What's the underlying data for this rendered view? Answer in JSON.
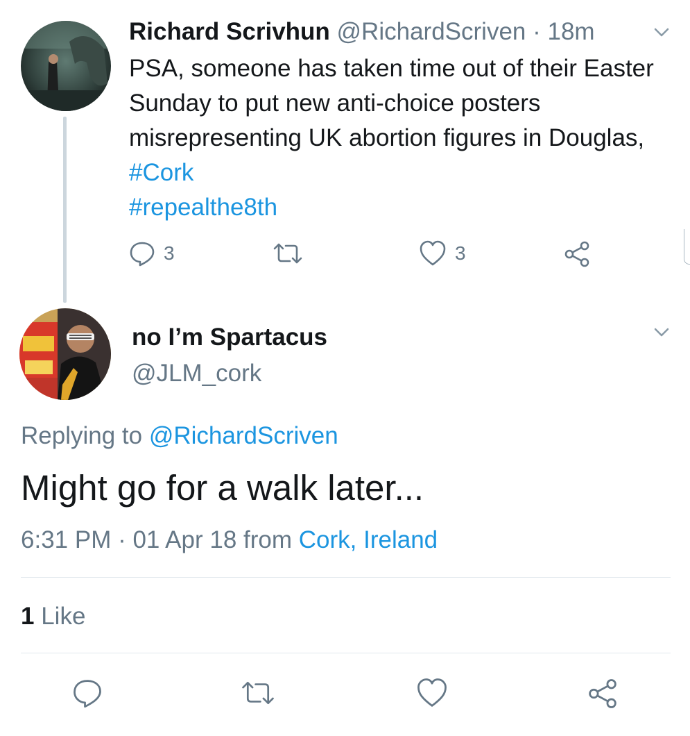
{
  "parent_tweet": {
    "display_name": "Richard Scrivhun",
    "handle": "@RichardScriven",
    "time": "18m",
    "text_plain": "PSA, someone has taken time out of their Easter Sunday to put new anti-choice posters misrepresenting UK abortion figures in Douglas,",
    "hashtag1": "#Cork",
    "hashtag2": "#repealthe8th",
    "reply_count": "3",
    "like_count": "3"
  },
  "reply_tweet": {
    "display_name": "no I’m Spartacus",
    "handle": "@JLM_cork",
    "replying_prefix": "Replying to",
    "replying_handle": "@RichardScriven",
    "text": "Might go for a walk later...",
    "timestamp": "6:31 PM · 01 Apr 18",
    "from_label": "from",
    "location": "Cork, Ireland",
    "like_count": "1",
    "like_label": "Like"
  },
  "icons": {
    "reply": "reply-icon",
    "retweet": "retweet-icon",
    "like": "heart-icon",
    "share": "share-icon",
    "menu": "chevron-down-icon"
  },
  "colors": {
    "link": "#1b95e0",
    "muted": "#657786",
    "text": "#14171a",
    "divider": "#e1e8ed"
  }
}
